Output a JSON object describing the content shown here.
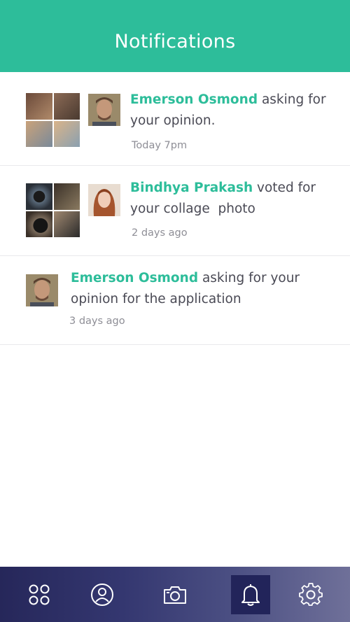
{
  "header": {
    "title": "Notifications"
  },
  "notifications": [
    {
      "name": "Emerson Osmond",
      "message_line1": " asking for",
      "message_line2": "your opinion.",
      "time": "Today 7pm"
    },
    {
      "name": "Bindhya Prakash",
      "message_line1": " voted for",
      "message_line2": "your collage  photo",
      "time": "2 days ago"
    },
    {
      "name": "Emerson Osmond",
      "message_line1": " asking for your",
      "message_line2": "opinion for the application",
      "time": "3 days ago"
    }
  ],
  "tabbar": {
    "items": [
      {
        "icon": "grid-icon",
        "active": false
      },
      {
        "icon": "profile-icon",
        "active": false
      },
      {
        "icon": "camera-icon",
        "active": false
      },
      {
        "icon": "bell-icon",
        "active": true
      },
      {
        "icon": "gear-icon",
        "active": false
      }
    ]
  },
  "colors": {
    "accent": "#2dbd9a",
    "tabbar_dark": "#26275a",
    "text": "#4a4a55",
    "muted": "#8e8e96"
  }
}
